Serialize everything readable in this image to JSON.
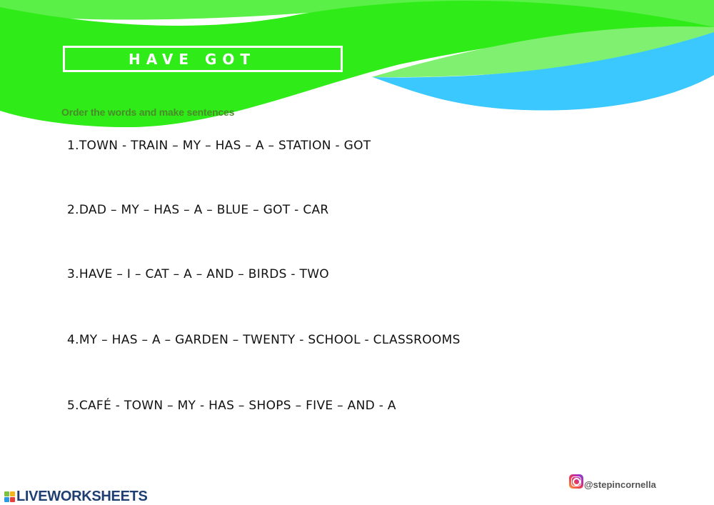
{
  "header": {
    "title": "HAVE GOT",
    "instruction": "Order the words and make sentences"
  },
  "colors": {
    "main_green": "#2feb18",
    "light_green": "#80f070",
    "top_band_green": "#5af048",
    "blue": "#3ac8ff",
    "logo_navy": "#1f3f73"
  },
  "exercises": [
    {
      "number": "1.",
      "words": "TOWN - TRAIN – MY – HAS – A – STATION - GOT"
    },
    {
      "number": "2.",
      "words": "DAD – MY – HAS – A – BLUE – GOT - CAR"
    },
    {
      "number": "3.",
      "words": "HAVE – I – CAT – A – AND – BIRDS - TWO"
    },
    {
      "number": "4.",
      "words": "MY – HAS – A – GARDEN – TWENTY - SCHOOL - CLASSROOMS"
    },
    {
      "number": "5.",
      "words": "CAFÉ - TOWN – MY - HAS – SHOPS – FIVE – AND - A"
    }
  ],
  "footer": {
    "brand": "LIVEWORKSHEETS",
    "brand_icon": "live-blocks-icon",
    "social_icon": "instagram-icon",
    "social_handle": "@stepincornella"
  }
}
